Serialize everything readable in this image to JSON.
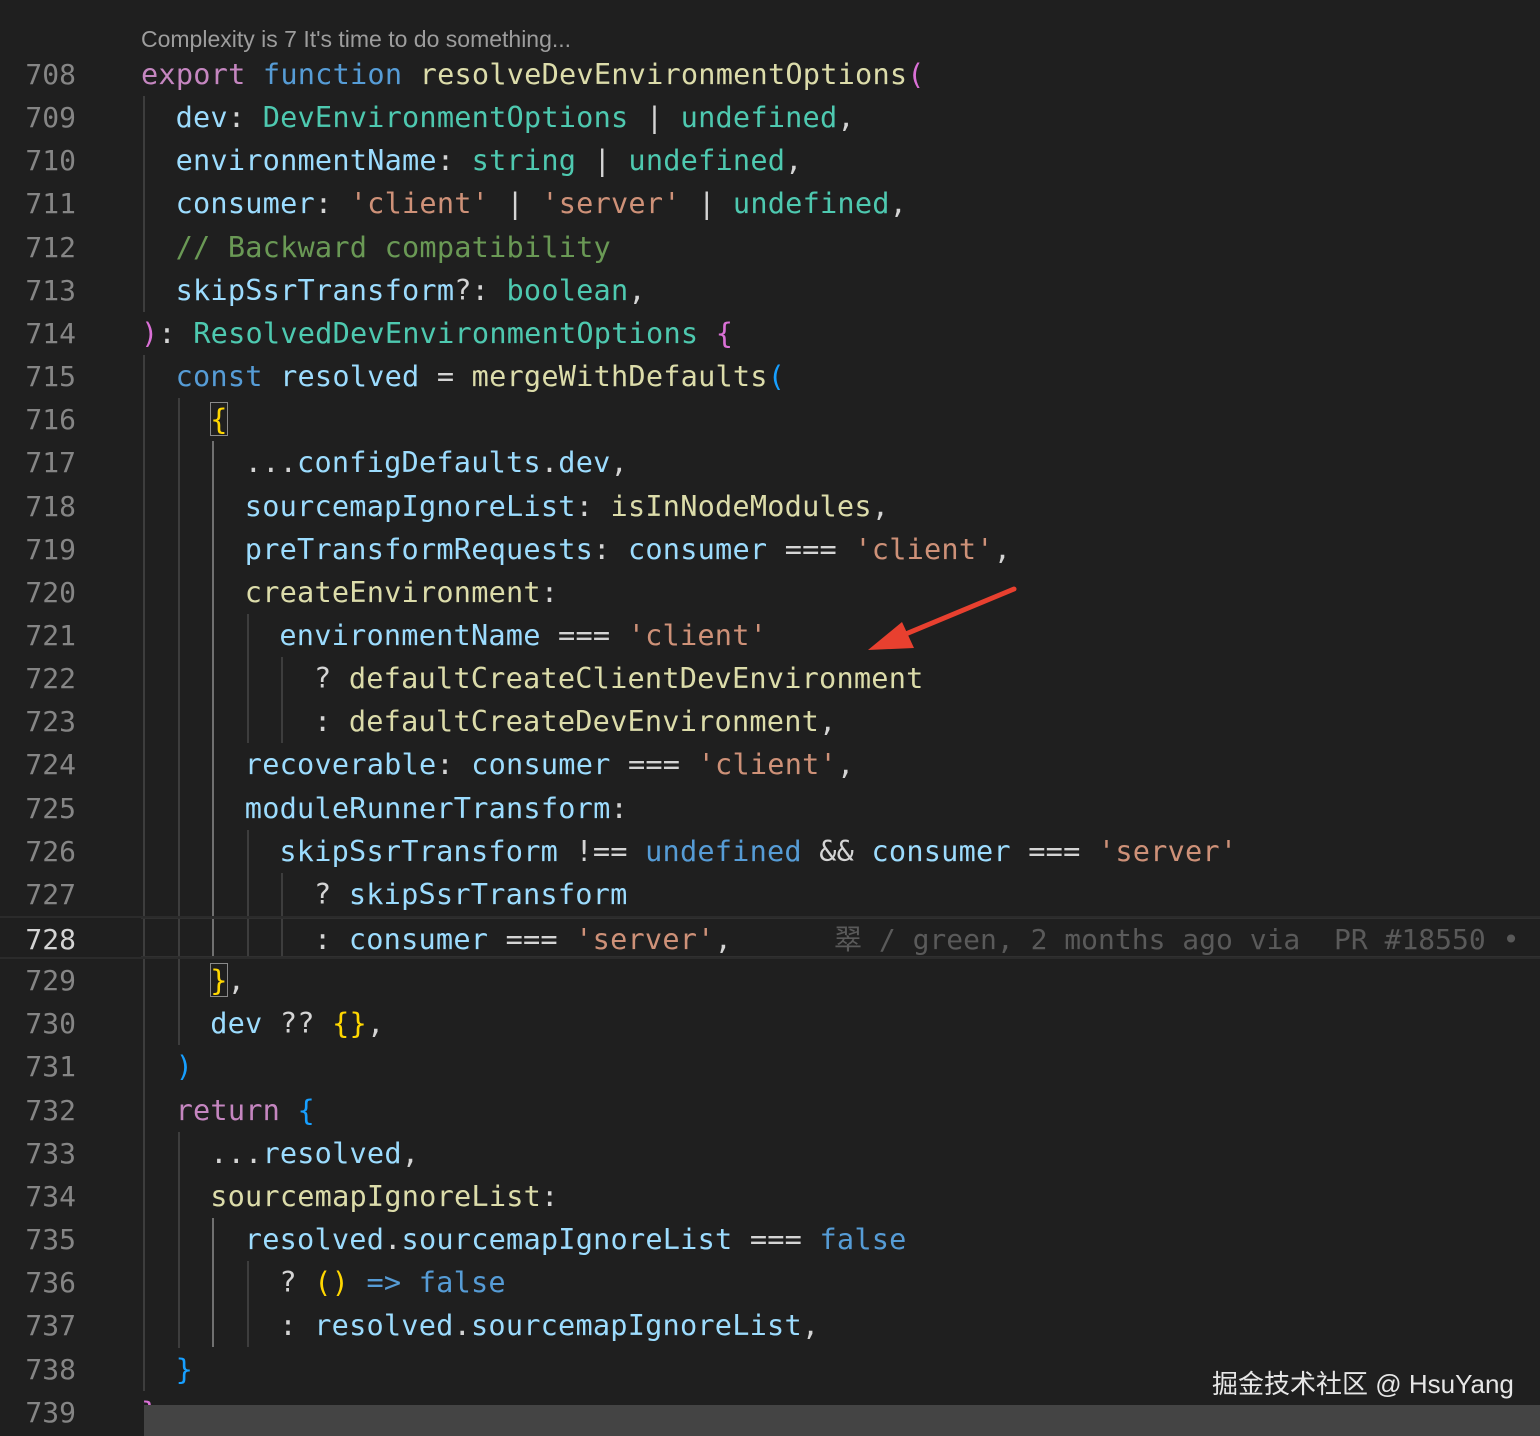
{
  "codelens": "Complexity is 7 It's time to do something...",
  "current_line": 728,
  "blame": "翠 / green, 2 months ago via  PR #18550 •",
  "watermark": "掘金技术社区 @ HsuYang",
  "colors": {
    "background": "#1f1f1f",
    "keyword": "#c586c0",
    "storage": "#569cd6",
    "function": "#dcdcaa",
    "type": "#4ec9b0",
    "variable": "#9cdcfe",
    "string": "#ce9178",
    "comment": "#6a9955",
    "annotation_arrow": "#e8402f"
  },
  "lines": [
    {
      "n": 708,
      "indent": 0,
      "tokens": [
        [
          "export",
          "kw"
        ],
        [
          " ",
          "pun"
        ],
        [
          "function",
          "st"
        ],
        [
          " ",
          "pun"
        ],
        [
          "resolveDevEnvironmentOptions",
          "fn"
        ],
        [
          "(",
          "p1"
        ]
      ]
    },
    {
      "n": 709,
      "indent": 1,
      "tokens": [
        [
          "dev",
          "var"
        ],
        [
          ": ",
          "pun"
        ],
        [
          "DevEnvironmentOptions",
          "ty"
        ],
        [
          " | ",
          "pun"
        ],
        [
          "undefined",
          "ty"
        ],
        [
          ",",
          "pun"
        ]
      ]
    },
    {
      "n": 710,
      "indent": 1,
      "tokens": [
        [
          "environmentName",
          "var"
        ],
        [
          ": ",
          "pun"
        ],
        [
          "string",
          "ty"
        ],
        [
          " | ",
          "pun"
        ],
        [
          "undefined",
          "ty"
        ],
        [
          ",",
          "pun"
        ]
      ]
    },
    {
      "n": 711,
      "indent": 1,
      "tokens": [
        [
          "consumer",
          "var"
        ],
        [
          ": ",
          "pun"
        ],
        [
          "'client'",
          "str"
        ],
        [
          " | ",
          "pun"
        ],
        [
          "'server'",
          "str"
        ],
        [
          " | ",
          "pun"
        ],
        [
          "undefined",
          "ty"
        ],
        [
          ",",
          "pun"
        ]
      ]
    },
    {
      "n": 712,
      "indent": 1,
      "tokens": [
        [
          "// Backward compatibility",
          "cmt"
        ]
      ]
    },
    {
      "n": 713,
      "indent": 1,
      "tokens": [
        [
          "skipSsrTransform",
          "var"
        ],
        [
          "?: ",
          "pun"
        ],
        [
          "boolean",
          "ty"
        ],
        [
          ",",
          "pun"
        ]
      ]
    },
    {
      "n": 714,
      "indent": 0,
      "tokens": [
        [
          ")",
          "p1"
        ],
        [
          ": ",
          "pun"
        ],
        [
          "ResolvedDevEnvironmentOptions",
          "ty"
        ],
        [
          " ",
          "pun"
        ],
        [
          "{",
          "p1"
        ]
      ]
    },
    {
      "n": 715,
      "indent": 1,
      "tokens": [
        [
          "const",
          "st"
        ],
        [
          " ",
          "pun"
        ],
        [
          "resolved",
          "var"
        ],
        [
          " = ",
          "pun"
        ],
        [
          "mergeWithDefaults",
          "fn"
        ],
        [
          "(",
          "p2"
        ]
      ]
    },
    {
      "n": 716,
      "indent": 2,
      "tokens": [
        [
          "{",
          "p3"
        ]
      ]
    },
    {
      "n": 717,
      "indent": 3,
      "tokens": [
        [
          "...",
          "pun"
        ],
        [
          "configDefaults",
          "var"
        ],
        [
          ".",
          "pun"
        ],
        [
          "dev",
          "var"
        ],
        [
          ",",
          "pun"
        ]
      ]
    },
    {
      "n": 718,
      "indent": 3,
      "tokens": [
        [
          "sourcemapIgnoreList",
          "var"
        ],
        [
          ": ",
          "pun"
        ],
        [
          "isInNodeModules",
          "fn"
        ],
        [
          ",",
          "pun"
        ]
      ]
    },
    {
      "n": 719,
      "indent": 3,
      "tokens": [
        [
          "preTransformRequests",
          "var"
        ],
        [
          ": ",
          "pun"
        ],
        [
          "consumer",
          "var"
        ],
        [
          " === ",
          "pun"
        ],
        [
          "'client'",
          "str"
        ],
        [
          ",",
          "pun"
        ]
      ]
    },
    {
      "n": 720,
      "indent": 3,
      "tokens": [
        [
          "createEnvironment",
          "fn"
        ],
        [
          ":",
          "pun"
        ]
      ]
    },
    {
      "n": 721,
      "indent": 4,
      "tokens": [
        [
          "environmentName",
          "var"
        ],
        [
          " === ",
          "pun"
        ],
        [
          "'client'",
          "str"
        ]
      ]
    },
    {
      "n": 722,
      "indent": 5,
      "tokens": [
        [
          "? ",
          "pun"
        ],
        [
          "defaultCreateClientDevEnvironment",
          "fn"
        ]
      ]
    },
    {
      "n": 723,
      "indent": 5,
      "tokens": [
        [
          ": ",
          "pun"
        ],
        [
          "defaultCreateDevEnvironment",
          "fn"
        ],
        [
          ",",
          "pun"
        ]
      ]
    },
    {
      "n": 724,
      "indent": 3,
      "tokens": [
        [
          "recoverable",
          "var"
        ],
        [
          ": ",
          "pun"
        ],
        [
          "consumer",
          "var"
        ],
        [
          " === ",
          "pun"
        ],
        [
          "'client'",
          "str"
        ],
        [
          ",",
          "pun"
        ]
      ]
    },
    {
      "n": 725,
      "indent": 3,
      "tokens": [
        [
          "moduleRunnerTransform",
          "var"
        ],
        [
          ":",
          "pun"
        ]
      ]
    },
    {
      "n": 726,
      "indent": 4,
      "tokens": [
        [
          "skipSsrTransform",
          "var"
        ],
        [
          " !== ",
          "pun"
        ],
        [
          "undefined",
          "st"
        ],
        [
          " && ",
          "pun"
        ],
        [
          "consumer",
          "var"
        ],
        [
          " === ",
          "pun"
        ],
        [
          "'server'",
          "str"
        ]
      ]
    },
    {
      "n": 727,
      "indent": 5,
      "tokens": [
        [
          "? ",
          "pun"
        ],
        [
          "skipSsrTransform",
          "var"
        ]
      ]
    },
    {
      "n": 728,
      "indent": 5,
      "tokens": [
        [
          ": ",
          "pun"
        ],
        [
          "consumer",
          "var"
        ],
        [
          " === ",
          "pun"
        ],
        [
          "'server'",
          "str"
        ],
        [
          ",",
          "pun"
        ]
      ]
    },
    {
      "n": 729,
      "indent": 2,
      "tokens": [
        [
          "}",
          "p3"
        ],
        [
          ",",
          "pun"
        ]
      ]
    },
    {
      "n": 730,
      "indent": 2,
      "tokens": [
        [
          "dev",
          "var"
        ],
        [
          " ?? ",
          "pun"
        ],
        [
          "{}",
          "p3"
        ],
        [
          ",",
          "pun"
        ]
      ]
    },
    {
      "n": 731,
      "indent": 1,
      "tokens": [
        [
          ")",
          "p2"
        ]
      ]
    },
    {
      "n": 732,
      "indent": 1,
      "tokens": [
        [
          "return",
          "kw"
        ],
        [
          " ",
          "pun"
        ],
        [
          "{",
          "p2"
        ]
      ]
    },
    {
      "n": 733,
      "indent": 2,
      "tokens": [
        [
          "...",
          "pun"
        ],
        [
          "resolved",
          "var"
        ],
        [
          ",",
          "pun"
        ]
      ]
    },
    {
      "n": 734,
      "indent": 2,
      "tokens": [
        [
          "sourcemapIgnoreList",
          "fn"
        ],
        [
          ":",
          "pun"
        ]
      ]
    },
    {
      "n": 735,
      "indent": 3,
      "tokens": [
        [
          "resolved",
          "var"
        ],
        [
          ".",
          "pun"
        ],
        [
          "sourcemapIgnoreList",
          "var"
        ],
        [
          " === ",
          "pun"
        ],
        [
          "false",
          "st"
        ]
      ]
    },
    {
      "n": 736,
      "indent": 4,
      "tokens": [
        [
          "? ",
          "pun"
        ],
        [
          "()",
          "p3"
        ],
        [
          " => ",
          "st"
        ],
        [
          "false",
          "st"
        ]
      ]
    },
    {
      "n": 737,
      "indent": 4,
      "tokens": [
        [
          ": ",
          "pun"
        ],
        [
          "resolved",
          "var"
        ],
        [
          ".",
          "pun"
        ],
        [
          "sourcemapIgnoreList",
          "var"
        ],
        [
          ",",
          "pun"
        ]
      ]
    },
    {
      "n": 738,
      "indent": 1,
      "tokens": [
        [
          "}",
          "p2"
        ]
      ]
    },
    {
      "n": 739,
      "indent": 0,
      "tokens": [
        [
          "}",
          "p1"
        ]
      ]
    }
  ]
}
